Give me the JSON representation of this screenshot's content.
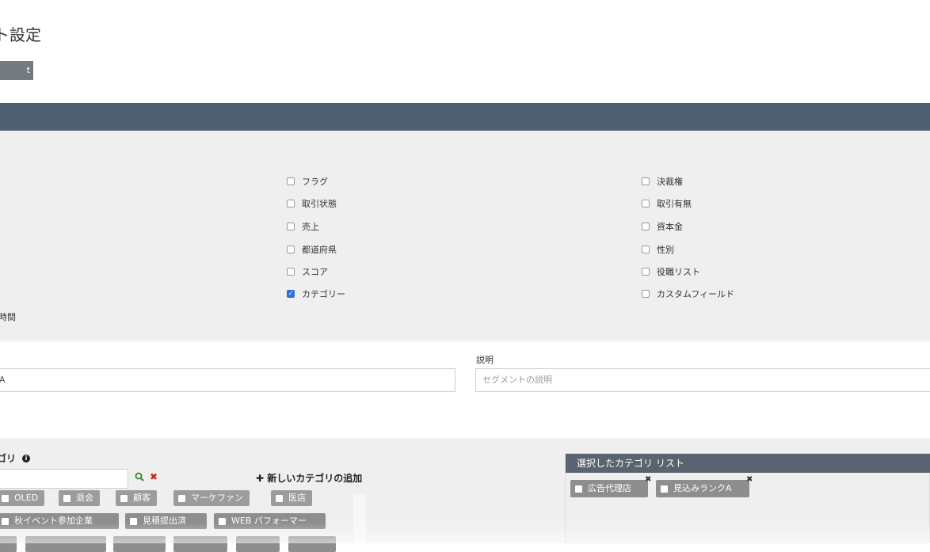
{
  "header": {
    "title": "ト設定",
    "button_label": "t"
  },
  "fields": {
    "col2": [
      {
        "label": "フラグ",
        "checked": false
      },
      {
        "label": "取引状態",
        "checked": false
      },
      {
        "label": "売上",
        "checked": false
      },
      {
        "label": "都道府県",
        "checked": false
      },
      {
        "label": "スコア",
        "checked": false
      },
      {
        "label": "カテゴリー",
        "checked": true
      }
    ],
    "col3": [
      {
        "label": "決裁権",
        "checked": false
      },
      {
        "label": "取引有無",
        "checked": false
      },
      {
        "label": "資本金",
        "checked": false
      },
      {
        "label": "性別",
        "checked": false
      },
      {
        "label": "役職リスト",
        "checked": false
      },
      {
        "label": "カスタムフィールド",
        "checked": false
      }
    ],
    "partial_label": "時間"
  },
  "form": {
    "name_value": "A",
    "description_label": "説明",
    "description_placeholder": "セグメントの説明"
  },
  "category": {
    "title": "ゴリ",
    "info_icon": "i",
    "search_icon": "search-icon",
    "clear_icon": "clear-icon",
    "add_label": "✚ 新しいカテゴリの追加",
    "tags_row1": [
      "OLED",
      "退会",
      "顧客",
      "マーケファン",
      "医店"
    ],
    "tags_row2": [
      "秋イベント参加企業",
      "見積提出済",
      "WEB パフォーマー"
    ],
    "selected_header": "選択したカテゴリ リスト",
    "selected": [
      "広告代理店",
      "見込みランクA"
    ]
  },
  "colors": {
    "header_bar": "#4d5f70",
    "checkbox_checked": "#2f6fd6",
    "tag": "#8e8e8e"
  }
}
